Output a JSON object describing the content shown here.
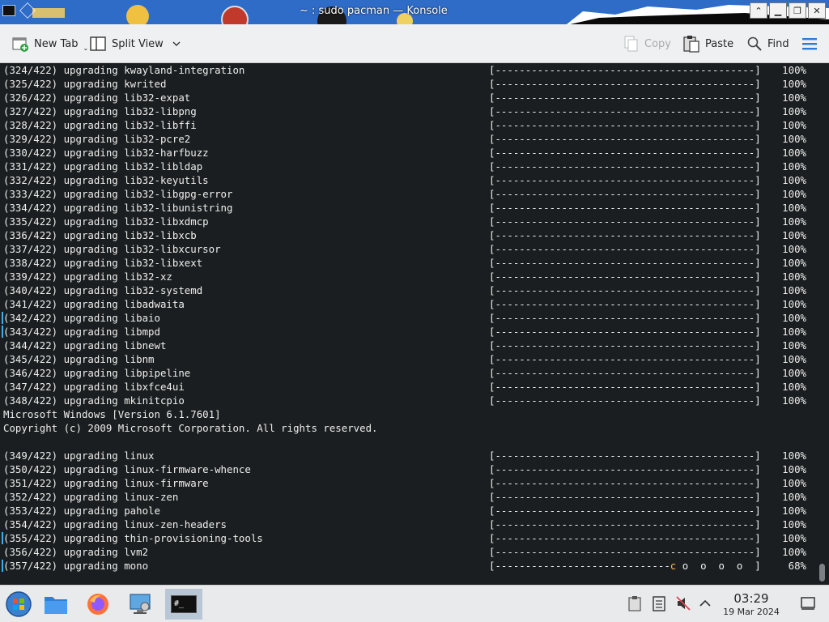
{
  "window": {
    "title": "~ : sudo pacman — Konsole",
    "buttons": {
      "keep_above": "⌃",
      "minimize": "▁",
      "maximize": "❐",
      "close": "✕"
    }
  },
  "toolbar": {
    "new_tab": "New Tab",
    "split_view": "Split View",
    "copy": "Copy",
    "paste": "Paste",
    "find": "Find"
  },
  "terminal": {
    "lines": [
      {
        "text": "(324/422) upgrading kwayland-integration",
        "pct": "100%"
      },
      {
        "text": "(325/422) upgrading kwrited",
        "pct": "100%"
      },
      {
        "text": "(326/422) upgrading lib32-expat",
        "pct": "100%"
      },
      {
        "text": "(327/422) upgrading lib32-libpng",
        "pct": "100%"
      },
      {
        "text": "(328/422) upgrading lib32-libffi",
        "pct": "100%"
      },
      {
        "text": "(329/422) upgrading lib32-pcre2",
        "pct": "100%"
      },
      {
        "text": "(330/422) upgrading lib32-harfbuzz",
        "pct": "100%"
      },
      {
        "text": "(331/422) upgrading lib32-libldap",
        "pct": "100%"
      },
      {
        "text": "(332/422) upgrading lib32-keyutils",
        "pct": "100%"
      },
      {
        "text": "(333/422) upgrading lib32-libgpg-error",
        "pct": "100%"
      },
      {
        "text": "(334/422) upgrading lib32-libunistring",
        "pct": "100%"
      },
      {
        "text": "(335/422) upgrading lib32-libxdmcp",
        "pct": "100%"
      },
      {
        "text": "(336/422) upgrading lib32-libxcb",
        "pct": "100%"
      },
      {
        "text": "(337/422) upgrading lib32-libxcursor",
        "pct": "100%"
      },
      {
        "text": "(338/422) upgrading lib32-libxext",
        "pct": "100%"
      },
      {
        "text": "(339/422) upgrading lib32-xz",
        "pct": "100%"
      },
      {
        "text": "(340/422) upgrading lib32-systemd",
        "pct": "100%"
      },
      {
        "text": "(341/422) upgrading libadwaita",
        "pct": "100%"
      },
      {
        "text": "(342/422) upgrading libaio",
        "pct": "100%"
      },
      {
        "text": "(343/422) upgrading libmpd",
        "pct": "100%"
      },
      {
        "text": "(344/422) upgrading libnewt",
        "pct": "100%"
      },
      {
        "text": "(345/422) upgrading libnm",
        "pct": "100%"
      },
      {
        "text": "(346/422) upgrading libpipeline",
        "pct": "100%"
      },
      {
        "text": "(347/422) upgrading libxfce4ui",
        "pct": "100%"
      },
      {
        "text": "(348/422) upgrading mkinitcpio",
        "pct": "100%"
      },
      {
        "text": "Microsoft Windows [Version 6.1.7601]",
        "pct": ""
      },
      {
        "text": "Copyright (c) 2009 Microsoft Corporation. All rights reserved.",
        "pct": ""
      },
      {
        "text": "",
        "pct": ""
      },
      {
        "text": "(349/422) upgrading linux",
        "pct": "100%"
      },
      {
        "text": "(350/422) upgrading linux-firmware-whence",
        "pct": "100%"
      },
      {
        "text": "(351/422) upgrading linux-firmware",
        "pct": "100%"
      },
      {
        "text": "(352/422) upgrading linux-zen",
        "pct": "100%"
      },
      {
        "text": "(353/422) upgrading pahole",
        "pct": "100%"
      },
      {
        "text": "(354/422) upgrading linux-zen-headers",
        "pct": "100%"
      },
      {
        "text": "(355/422) upgrading thin-provisioning-tools",
        "pct": "100%"
      },
      {
        "text": "(356/422) upgrading lvm2",
        "pct": "100%"
      },
      {
        "text": "(357/422) upgrading mono",
        "pct": "68%"
      }
    ]
  },
  "taskbar": {
    "clock_time": "03:29",
    "clock_date": "19 Mar 2024",
    "terminal_icon_text": "#_"
  },
  "colors": {
    "terminal_bg": "#1b1e20",
    "terminal_fg": "#eeeeee",
    "pacman": "#f6b84f",
    "toolbar_bg": "#eff0f1",
    "accent": "#3daee9"
  }
}
